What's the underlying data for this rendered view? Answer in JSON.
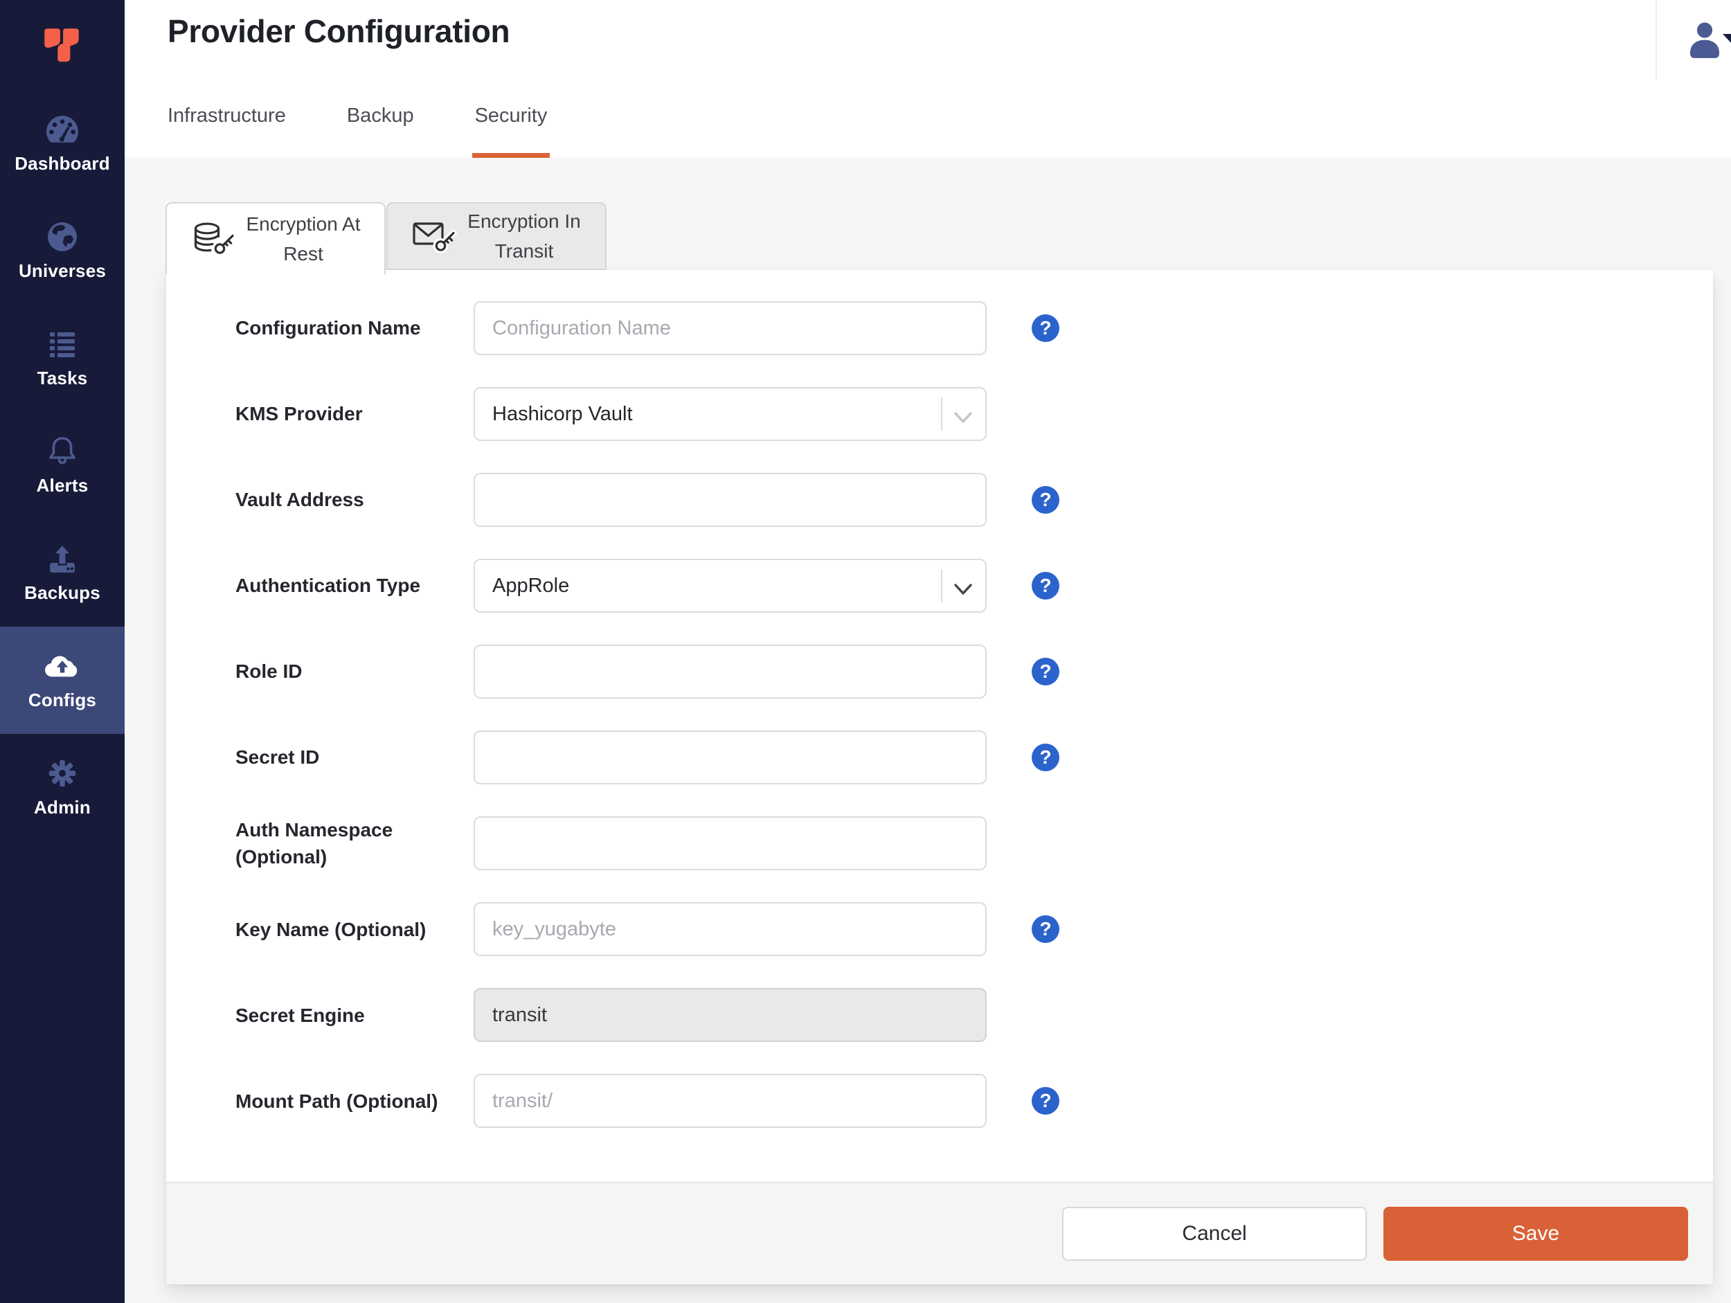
{
  "colors": {
    "accent_orange": "#DC6236",
    "save_button_orange": "#D96137",
    "help_blue": "#2B63CD",
    "logo_orange": "#F4604A",
    "sidebar_bg": "#171A38",
    "sidebar_active_bg": "#3C4878"
  },
  "sidebar": {
    "logo_icon": "yugabyte-logo",
    "items": [
      {
        "id": "dashboard",
        "label": "Dashboard",
        "icon": "gauge-icon",
        "active": false
      },
      {
        "id": "universes",
        "label": "Universes",
        "icon": "globe-icon",
        "active": false
      },
      {
        "id": "tasks",
        "label": "Tasks",
        "icon": "list-icon",
        "active": false
      },
      {
        "id": "alerts",
        "label": "Alerts",
        "icon": "bell-icon",
        "active": false
      },
      {
        "id": "backups",
        "label": "Backups",
        "icon": "upload-icon",
        "active": false
      },
      {
        "id": "configs",
        "label": "Configs",
        "icon": "cloud-upload-icon",
        "active": true
      },
      {
        "id": "admin",
        "label": "Admin",
        "icon": "gear-icon",
        "active": false
      }
    ]
  },
  "header": {
    "title": "Provider Configuration",
    "tabs": [
      {
        "id": "infrastructure",
        "label": "Infrastructure",
        "active": false
      },
      {
        "id": "backup",
        "label": "Backup",
        "active": false
      },
      {
        "id": "security",
        "label": "Security",
        "active": true
      }
    ],
    "user_icon": "user-icon",
    "caret_icon": "caret-down-icon"
  },
  "security_tabs": [
    {
      "id": "encryption-at-rest",
      "line1": "Encryption At",
      "line2": "Rest",
      "icon": "database-key-icon",
      "active": true
    },
    {
      "id": "encryption-in-transit",
      "line1": "Encryption In",
      "line2": "Transit",
      "icon": "envelope-key-icon",
      "active": false
    }
  ],
  "form": {
    "help_glyph": "?",
    "rows": [
      {
        "id": "configuration-name",
        "label": "Configuration Name",
        "control": "input",
        "value": "",
        "placeholder": "Configuration Name",
        "help": true
      },
      {
        "id": "kms-provider",
        "label": "KMS Provider",
        "control": "select",
        "value": "Hashicorp Vault",
        "chevron": "light",
        "help": false
      },
      {
        "id": "vault-address",
        "label": "Vault Address",
        "control": "input",
        "value": "",
        "placeholder": "",
        "help": true
      },
      {
        "id": "authentication-type",
        "label": "Authentication Type",
        "control": "select",
        "value": "AppRole",
        "chevron": "dark",
        "help": true
      },
      {
        "id": "role-id",
        "label": "Role ID",
        "control": "input",
        "value": "",
        "placeholder": "",
        "help": true
      },
      {
        "id": "secret-id",
        "label": "Secret ID",
        "control": "input",
        "value": "",
        "placeholder": "",
        "help": true
      },
      {
        "id": "auth-namespace",
        "label": "Auth Namespace (Optional)",
        "control": "input",
        "value": "",
        "placeholder": "",
        "help": false
      },
      {
        "id": "key-name",
        "label": "Key Name (Optional)",
        "control": "input",
        "value": "",
        "placeholder": "key_yugabyte",
        "help": true
      },
      {
        "id": "secret-engine",
        "label": "Secret Engine",
        "control": "input",
        "value": "transit",
        "placeholder": "",
        "disabled": true,
        "help": false
      },
      {
        "id": "mount-path",
        "label": "Mount Path (Optional)",
        "control": "input",
        "value": "",
        "placeholder": "transit/",
        "help": true
      }
    ]
  },
  "footer": {
    "cancel_label": "Cancel",
    "save_label": "Save"
  }
}
